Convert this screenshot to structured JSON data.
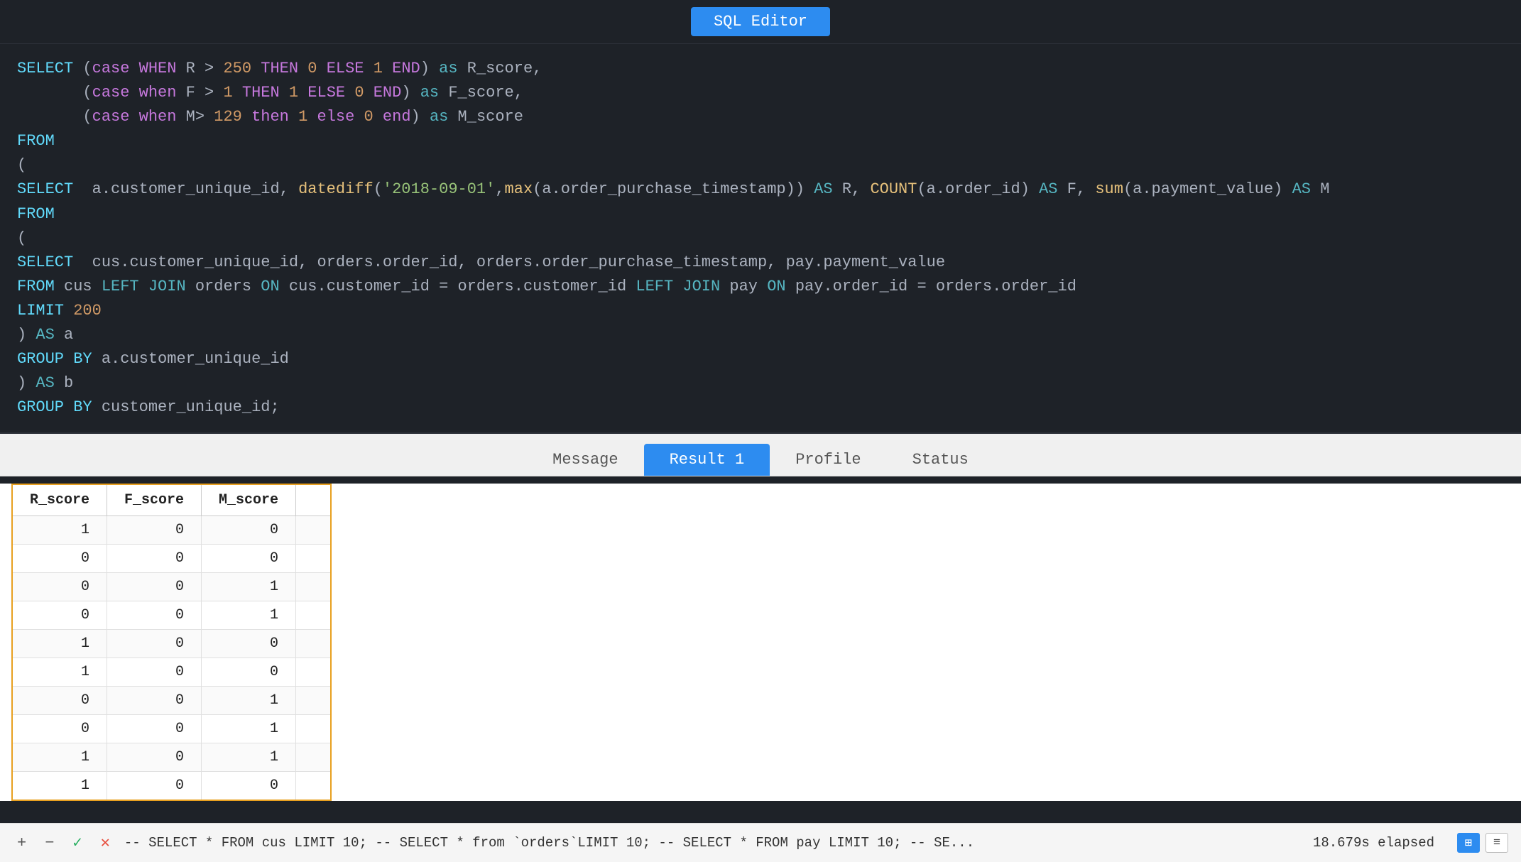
{
  "topbar": {
    "button_label": "SQL Editor"
  },
  "editor": {
    "lines": [
      {
        "id": "l1",
        "content": "SELECT (case WHEN R > 250 THEN 0 ELSE 1 END) as R_score,"
      },
      {
        "id": "l2",
        "content": "       (case when F > 1 THEN 1 ELSE 0 END) as F_score,"
      },
      {
        "id": "l3",
        "content": "       (case when M> 129 then 1 else 0 end) as M_score"
      },
      {
        "id": "l4",
        "content": "FROM"
      },
      {
        "id": "l5",
        "content": "("
      },
      {
        "id": "l6",
        "content": "SELECT  a.customer_unique_id, datediff('2018-09-01',max(a.order_purchase_timestamp)) AS R, COUNT(a.order_id) AS F, sum(a.payment_value) AS M"
      },
      {
        "id": "l7",
        "content": "FROM"
      },
      {
        "id": "l8",
        "content": "("
      },
      {
        "id": "l9",
        "content": "SELECT  cus.customer_unique_id, orders.order_id, orders.order_purchase_timestamp, pay.payment_value"
      },
      {
        "id": "l10",
        "content": "FROM cus LEFT JOIN orders ON cus.customer_id = orders.customer_id LEFT JOIN pay ON pay.order_id = orders.order_id"
      },
      {
        "id": "l11",
        "content": "LIMIT 200"
      },
      {
        "id": "l12",
        "content": ") AS a"
      },
      {
        "id": "l13",
        "content": "GROUP BY a.customer_unique_id"
      },
      {
        "id": "l14",
        "content": ") AS b"
      },
      {
        "id": "l15",
        "content": "GROUP BY customer_unique_id;"
      }
    ]
  },
  "tabs": [
    {
      "id": "message",
      "label": "Message",
      "active": false
    },
    {
      "id": "result1",
      "label": "Result 1",
      "active": true
    },
    {
      "id": "profile",
      "label": "Profile",
      "active": false
    },
    {
      "id": "status",
      "label": "Status",
      "active": false
    }
  ],
  "result_table": {
    "columns": [
      "R_score",
      "F_score",
      "M_score"
    ],
    "rows": [
      [
        1,
        0,
        0
      ],
      [
        0,
        0,
        0
      ],
      [
        0,
        0,
        1
      ],
      [
        0,
        0,
        1
      ],
      [
        1,
        0,
        0
      ],
      [
        1,
        0,
        0
      ],
      [
        0,
        0,
        1
      ],
      [
        0,
        0,
        1
      ],
      [
        1,
        0,
        1
      ],
      [
        1,
        0,
        0
      ]
    ]
  },
  "bottom_bar": {
    "status_text": "-- SELECT * FROM cus LIMIT 10; -- SELECT * from `orders`LIMIT 10; -- SELECT * FROM pay LIMIT 10; -- SE...",
    "elapsed_text": "18.679s elapsed",
    "icons": {
      "plus": "+",
      "minus": "−",
      "check": "✓",
      "close": "✕"
    },
    "view_grid": "⊞",
    "view_list": "≡"
  }
}
